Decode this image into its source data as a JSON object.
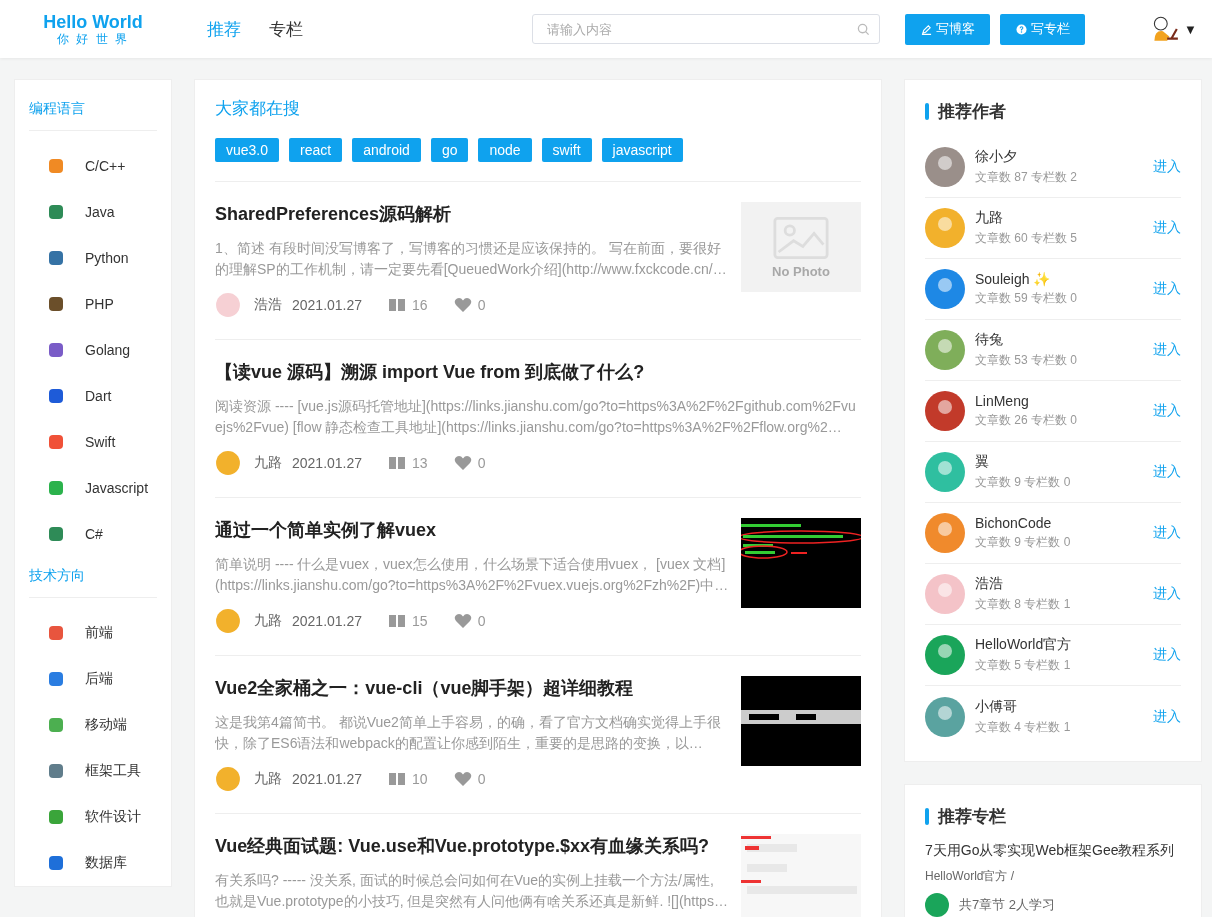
{
  "header": {
    "logo_title": "Hello World",
    "logo_subtitle": "你 好 世 界",
    "nav": [
      {
        "label": "推荐",
        "selected": true
      },
      {
        "label": "专栏",
        "selected": false
      }
    ],
    "search": {
      "placeholder": "请输入内容"
    },
    "buttons": [
      {
        "label": "写博客",
        "kind": "pen"
      },
      {
        "label": "写专栏",
        "kind": "help"
      }
    ],
    "user_menu": {
      "caret": "▼"
    }
  },
  "sidebar": {
    "sections": [
      {
        "title": "编程语言",
        "items": [
          "C/C++",
          "Java",
          "Python",
          "PHP",
          "Golang",
          "Dart",
          "Swift",
          "Javascript",
          "C#"
        ]
      },
      {
        "title": "技术方向",
        "items": [
          "前端",
          "后端",
          "移动端",
          "框架工具",
          "软件设计",
          "数据库"
        ]
      }
    ]
  },
  "hot_search": {
    "title": "大家都在搜",
    "tags": [
      "vue3.0",
      "react",
      "android",
      "go",
      "node",
      "swift",
      "javascript"
    ]
  },
  "articles": [
    {
      "title": "SharedPreferences源码解析",
      "summary": "1、简述 有段时间没写博客了，写博客的习惯还是应该保持的。 写在前面，要很好的理解SP的工作机制，请一定要先看[QueuedWork介绍](http://www.fxckcode.cn/…",
      "author": "浩浩",
      "date": "2021.01.27",
      "reads": "16",
      "likes": "0",
      "thumb": {
        "kind": "no_photo",
        "label": "No Photo"
      }
    },
    {
      "title": "【读vue 源码】溯源 import Vue from 到底做了什么?",
      "summary": "阅读资源 ---- [vue.js源码托管地址](https://links.jianshu.com/go?to=https%3A%2F%2Fgithub.com%2Fvuejs%2Fvue) [flow 静态检查工具地址](https://links.jianshu.com/go?to=https%3A%2F%2Fflow.org%2…",
      "author": "九路",
      "date": "2021.01.27",
      "reads": "13",
      "likes": "0"
    },
    {
      "title": "通过一个简单实例了解vuex",
      "summary": "简单说明 ---- 什么是vuex，vuex怎么使用，什么场景下适合使用vuex， [vuex 文档](https://links.jianshu.com/go?to=https%3A%2F%2Fvuex.vuejs.org%2Fzh%2F)中…",
      "author": "九路",
      "date": "2021.01.27",
      "reads": "15",
      "likes": "0"
    },
    {
      "title": "Vue2全家桶之一：vue-cli（vue脚手架）超详细教程",
      "summary": "这是我第4篇简书。        都说Vue2简单上手容易，的确，看了官方文档确实觉得上手很快，除了ES6语法和webpack的配置让你感到陌生，重要的是思路的变换，以…",
      "author": "九路",
      "date": "2021.01.27",
      "reads": "10",
      "likes": "0"
    },
    {
      "title": "Vue经典面试题: Vue.use和Vue.prototype.$xx有血缘关系吗?",
      "summary": "有关系吗? ----- 没关系, 面试的时候总会问如何在Vue的实例上挂载一个方法/属性, 也就是Vue.prototype的小技巧, 但是突然有人问他俩有啥关系还真是新鲜. ![](https…"
    }
  ],
  "authors": {
    "title": "推荐作者",
    "items": [
      {
        "name": "徐小夕",
        "stats": "文章数 87 专栏数 2",
        "enter": "进入"
      },
      {
        "name": "九路",
        "stats": "文章数 60 专栏数 5",
        "enter": "进入"
      },
      {
        "name": "Souleigh ✨",
        "stats": "文章数 59 专栏数 0",
        "enter": "进入"
      },
      {
        "name": "待兔",
        "stats": "文章数 53 专栏数 0",
        "enter": "进入"
      },
      {
        "name": "LinMeng",
        "stats": "文章数 26 专栏数 0",
        "enter": "进入"
      },
      {
        "name": "翼",
        "stats": "文章数 9 专栏数 0",
        "enter": "进入"
      },
      {
        "name": "BichonCode",
        "stats": "文章数 9 专栏数 0",
        "enter": "进入"
      },
      {
        "name": "浩浩",
        "stats": "文章数 8 专栏数 1",
        "enter": "进入"
      },
      {
        "name": "HelloWorld官方",
        "stats": "文章数 5 专栏数 1",
        "enter": "进入"
      },
      {
        "name": "小傅哥",
        "stats": "文章数 4 专栏数 1",
        "enter": "进入"
      }
    ]
  },
  "columns": {
    "title": "推荐专栏",
    "items": [
      {
        "title": "7天用Go从零实现Web框架Gee教程系列",
        "author": "HelloWorld官方 /",
        "info": "共7章节 2人学习"
      }
    ]
  }
}
